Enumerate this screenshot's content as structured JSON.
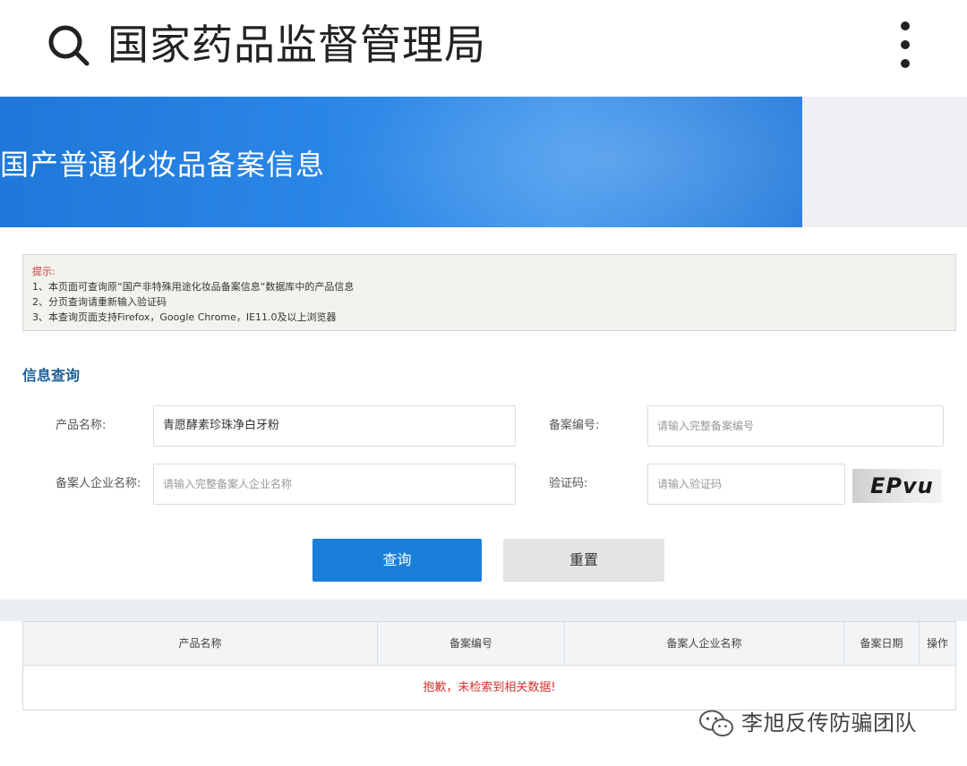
{
  "app_bar": {
    "title": "国家药品监督管理局"
  },
  "banner": {
    "title": "国产普通化妆品备案信息"
  },
  "notice": {
    "heading": "提示:",
    "lines": [
      "1、本页面可查询原“国产非特殊用途化妆品备案信息“数据库中的产品信息",
      "2、分页查询请重新输入验证码",
      "3、本查询页面支持Firefox，Google Chrome，IE11.0及以上浏览器"
    ]
  },
  "query": {
    "section_title": "信息查询",
    "product_name_label": "产品名称:",
    "product_name_value": "青愿酵素珍珠净白牙粉",
    "record_no_label": "备案编号:",
    "record_no_placeholder": "请输入完整备案编号",
    "company_label": "备案人企业名称:",
    "company_placeholder": "请输入完整备案人企业名称",
    "captcha_label": "验证码:",
    "captcha_placeholder": "请输入验证码",
    "captcha_image_text": "EPvu",
    "query_button": "查询",
    "reset_button": "重置"
  },
  "results_table": {
    "columns": [
      "产品名称",
      "备案编号",
      "备案人企业名称",
      "备案日期",
      "操作"
    ],
    "empty_message": "抱歉，未检索到相关数据!"
  },
  "watermark": {
    "text": "李旭反传防骗团队",
    "icon": "wechat-icon"
  }
}
